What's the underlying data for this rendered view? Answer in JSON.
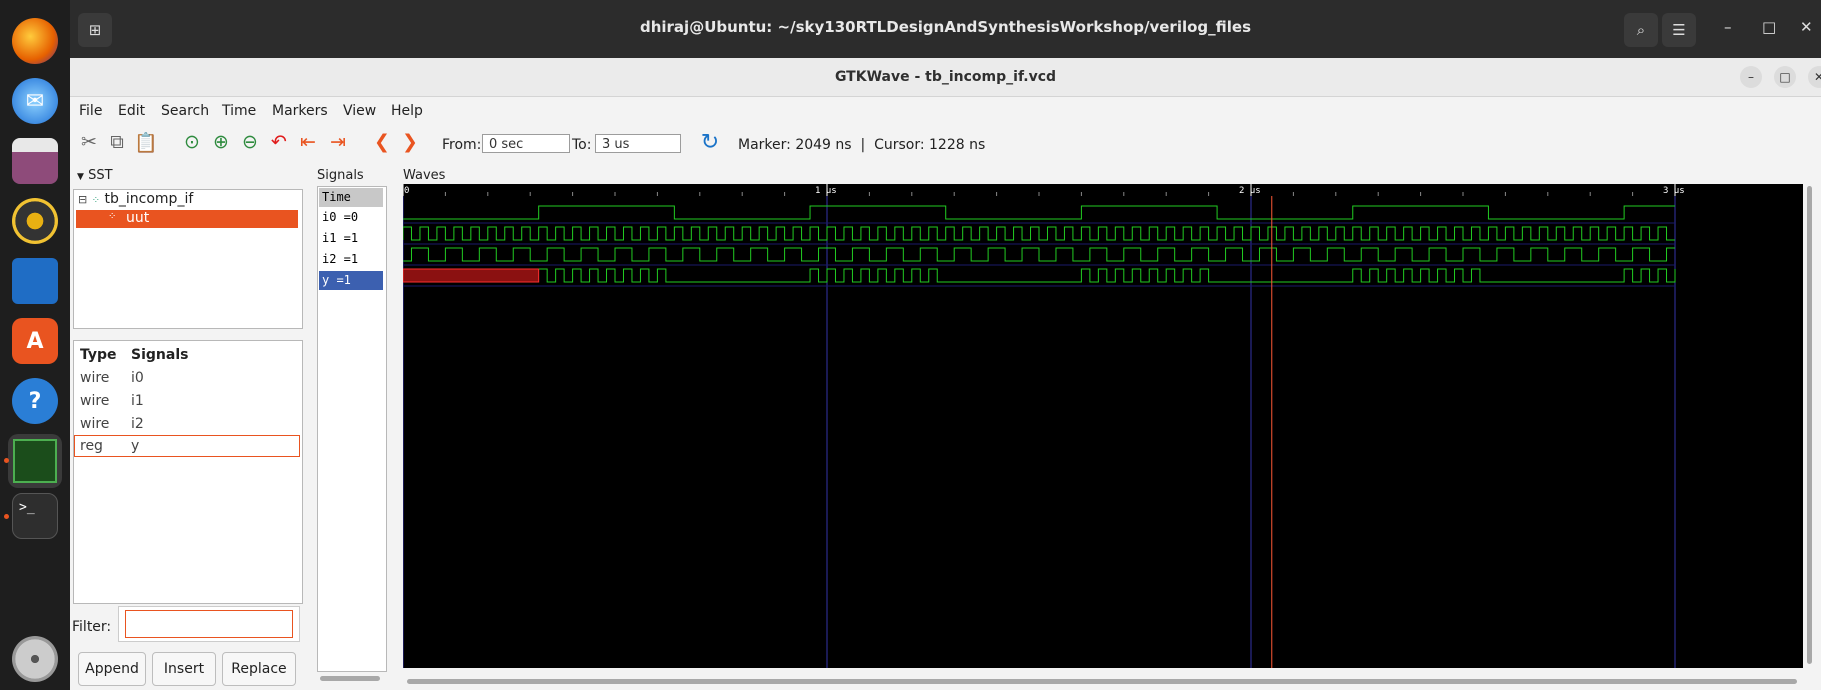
{
  "terminal": {
    "title": "dhiraj@Ubuntu: ~/sky130RTLDesignAndSynthesisWorkshop/verilog_files"
  },
  "window": {
    "title": "GTKWave - tb_incomp_if.vcd"
  },
  "menu": [
    "File",
    "Edit",
    "Search",
    "Time",
    "Markers",
    "View",
    "Help"
  ],
  "toolbar": {
    "from_label": "From:",
    "from_value": "0 sec",
    "to_label": "To:",
    "to_value": "3 us",
    "marker_text": "Marker: 2049 ns  |  Cursor: 1228 ns"
  },
  "sst": {
    "header": "SST",
    "tree": [
      {
        "label": "tb_incomp_if"
      },
      {
        "label": "uut"
      }
    ]
  },
  "signal_table": {
    "headers": {
      "type": "Type",
      "signals": "Signals"
    },
    "rows": [
      {
        "type": "wire",
        "name": "i0"
      },
      {
        "type": "wire",
        "name": "i1"
      },
      {
        "type": "wire",
        "name": "i2"
      },
      {
        "type": "reg",
        "name": "y"
      }
    ]
  },
  "filter": {
    "label": "Filter:",
    "value": ""
  },
  "buttons": {
    "append": "Append",
    "insert": "Insert",
    "replace": "Replace"
  },
  "signals_panel": {
    "header": "Signals",
    "rows": [
      {
        "label": "Time"
      },
      {
        "label": "i0 =0"
      },
      {
        "label": "i1 =1"
      },
      {
        "label": "i2 =1"
      },
      {
        "label": "y =1"
      }
    ]
  },
  "waves": {
    "header": "Waves",
    "time_range_ns": [
      0,
      3000
    ],
    "ticks": [
      {
        "t": 0,
        "label": "0"
      },
      {
        "t": 1000,
        "label": "1 us"
      },
      {
        "t": 2000,
        "label": "2 us"
      },
      {
        "t": 3000,
        "label": "3 us"
      }
    ],
    "marker_ns": 2049,
    "cursor_ns": 1228,
    "colors": {
      "wave": "#22cc22",
      "marker": "#ff5a36",
      "grid": "#3434a8",
      "undefined": "#8b1111",
      "undefined_border": "#ff3030"
    },
    "signals": [
      {
        "name": "i0",
        "period_ns": 640,
        "phase_ns": 320
      },
      {
        "name": "i1",
        "period_ns": 40,
        "phase_ns": 0
      },
      {
        "name": "i2",
        "period_ns": 80,
        "phase_ns": 20
      },
      {
        "name": "y",
        "undefined_until_ns": 320
      }
    ]
  }
}
